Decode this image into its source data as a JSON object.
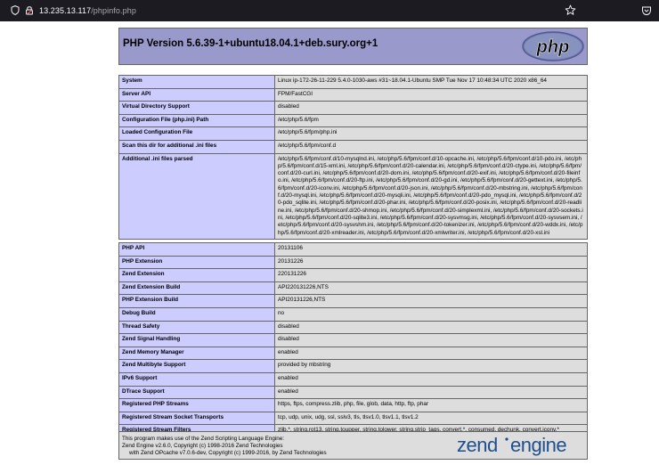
{
  "browser": {
    "url_host": "13.235.13.117",
    "url_path": "/phpinfo.php"
  },
  "header": {
    "title": "PHP Version 5.6.39-1+ubuntu18.04.1+deb.sury.org+1",
    "logo_text": "php"
  },
  "table1": [
    {
      "k": "System",
      "v": "Linux ip-172-26-11-229 5.4.0-1030-aws #31~18.04.1-Ubuntu SMP Tue Nov 17 10:48:34 UTC 2020 x86_64"
    },
    {
      "k": "Server API",
      "v": "FPM/FastCGI"
    },
    {
      "k": "Virtual Directory Support",
      "v": "disabled"
    },
    {
      "k": "Configuration File (php.ini) Path",
      "v": "/etc/php/5.6/fpm"
    },
    {
      "k": "Loaded Configuration File",
      "v": "/etc/php/5.6/fpm/php.ini"
    },
    {
      "k": "Scan this dir for additional .ini files",
      "v": "/etc/php/5.6/fpm/conf.d"
    },
    {
      "k": "Additional .ini files parsed",
      "v": "/etc/php/5.6/fpm/conf.d/10-mysqlnd.ini, /etc/php/5.6/fpm/conf.d/10-opcache.ini, /etc/php/5.6/fpm/conf.d/10-pdo.ini, /etc/php/5.6/fpm/conf.d/15-xml.ini, /etc/php/5.6/fpm/conf.d/20-calendar.ini, /etc/php/5.6/fpm/conf.d/20-ctype.ini, /etc/php/5.6/fpm/conf.d/20-curl.ini, /etc/php/5.6/fpm/conf.d/20-dom.ini, /etc/php/5.6/fpm/conf.d/20-exif.ini, /etc/php/5.6/fpm/conf.d/20-fileinfo.ini, /etc/php/5.6/fpm/conf.d/20-ftp.ini, /etc/php/5.6/fpm/conf.d/20-gd.ini, /etc/php/5.6/fpm/conf.d/20-gettext.ini, /etc/php/5.6/fpm/conf.d/20-iconv.ini, /etc/php/5.6/fpm/conf.d/20-json.ini, /etc/php/5.6/fpm/conf.d/20-mbstring.ini, /etc/php/5.6/fpm/conf.d/20-mysql.ini, /etc/php/5.6/fpm/conf.d/20-mysqli.ini, /etc/php/5.6/fpm/conf.d/20-pdo_mysql.ini, /etc/php/5.6/fpm/conf.d/20-pdo_sqlite.ini, /etc/php/5.6/fpm/conf.d/20-phar.ini, /etc/php/5.6/fpm/conf.d/20-posix.ini, /etc/php/5.6/fpm/conf.d/20-readline.ini, /etc/php/5.6/fpm/conf.d/20-shmop.ini, /etc/php/5.6/fpm/conf.d/20-simplexml.ini, /etc/php/5.6/fpm/conf.d/20-sockets.ini, /etc/php/5.6/fpm/conf.d/20-sqlite3.ini, /etc/php/5.6/fpm/conf.d/20-sysvmsg.ini, /etc/php/5.6/fpm/conf.d/20-sysvsem.ini, /etc/php/5.6/fpm/conf.d/20-sysvshm.ini, /etc/php/5.6/fpm/conf.d/20-tokenizer.ini, /etc/php/5.6/fpm/conf.d/20-wddx.ini, /etc/php/5.6/fpm/conf.d/20-xmlreader.ini, /etc/php/5.6/fpm/conf.d/20-xmlwriter.ini, /etc/php/5.6/fpm/conf.d/20-xsl.ini"
    }
  ],
  "table2": [
    {
      "k": "PHP API",
      "v": "20131106"
    },
    {
      "k": "PHP Extension",
      "v": "20131226"
    },
    {
      "k": "Zend Extension",
      "v": "220131226"
    },
    {
      "k": "Zend Extension Build",
      "v": "API220131226,NTS"
    },
    {
      "k": "PHP Extension Build",
      "v": "API20131226,NTS"
    },
    {
      "k": "Debug Build",
      "v": "no"
    },
    {
      "k": "Thread Safety",
      "v": "disabled"
    },
    {
      "k": "Zend Signal Handling",
      "v": "disabled"
    },
    {
      "k": "Zend Memory Manager",
      "v": "enabled"
    },
    {
      "k": "Zend Multibyte Support",
      "v": "provided by mbstring"
    },
    {
      "k": "IPv6 Support",
      "v": "enabled"
    },
    {
      "k": "DTrace Support",
      "v": "enabled"
    },
    {
      "k": "Registered PHP Streams",
      "v": "https, ftps, compress.zlib, php, file, glob, data, http, ftp, phar"
    },
    {
      "k": "Registered Stream Socket Transports",
      "v": "tcp, udp, unix, udg, ssl, sslv3, tls, tlsv1.0, tlsv1.1, tlsv1.2"
    },
    {
      "k": "Registered Stream Filters",
      "v": "zlib.*, string.rot13, string.toupper, string.tolower, string.strip_tags, convert.*, consumed, dechunk, convert.iconv.*"
    }
  ],
  "zend": {
    "line1": "This program makes use of the Zend Scripting Language Engine:",
    "line2": "Zend Engine v2.6.0, Copyright (c) 1998-2016 Zend Technologies",
    "line3": "with Zend OPcache v7.0.6-dev, Copyright (c) 1999-2016, by Zend Technologies",
    "logo_word1": "zend",
    "logo_word2": "engine"
  },
  "colors": {
    "header_bg": "#9999cc",
    "key_bg": "#ccccff",
    "value_bg": "#dddddd",
    "toolbar_bg": "#1c1b22"
  }
}
